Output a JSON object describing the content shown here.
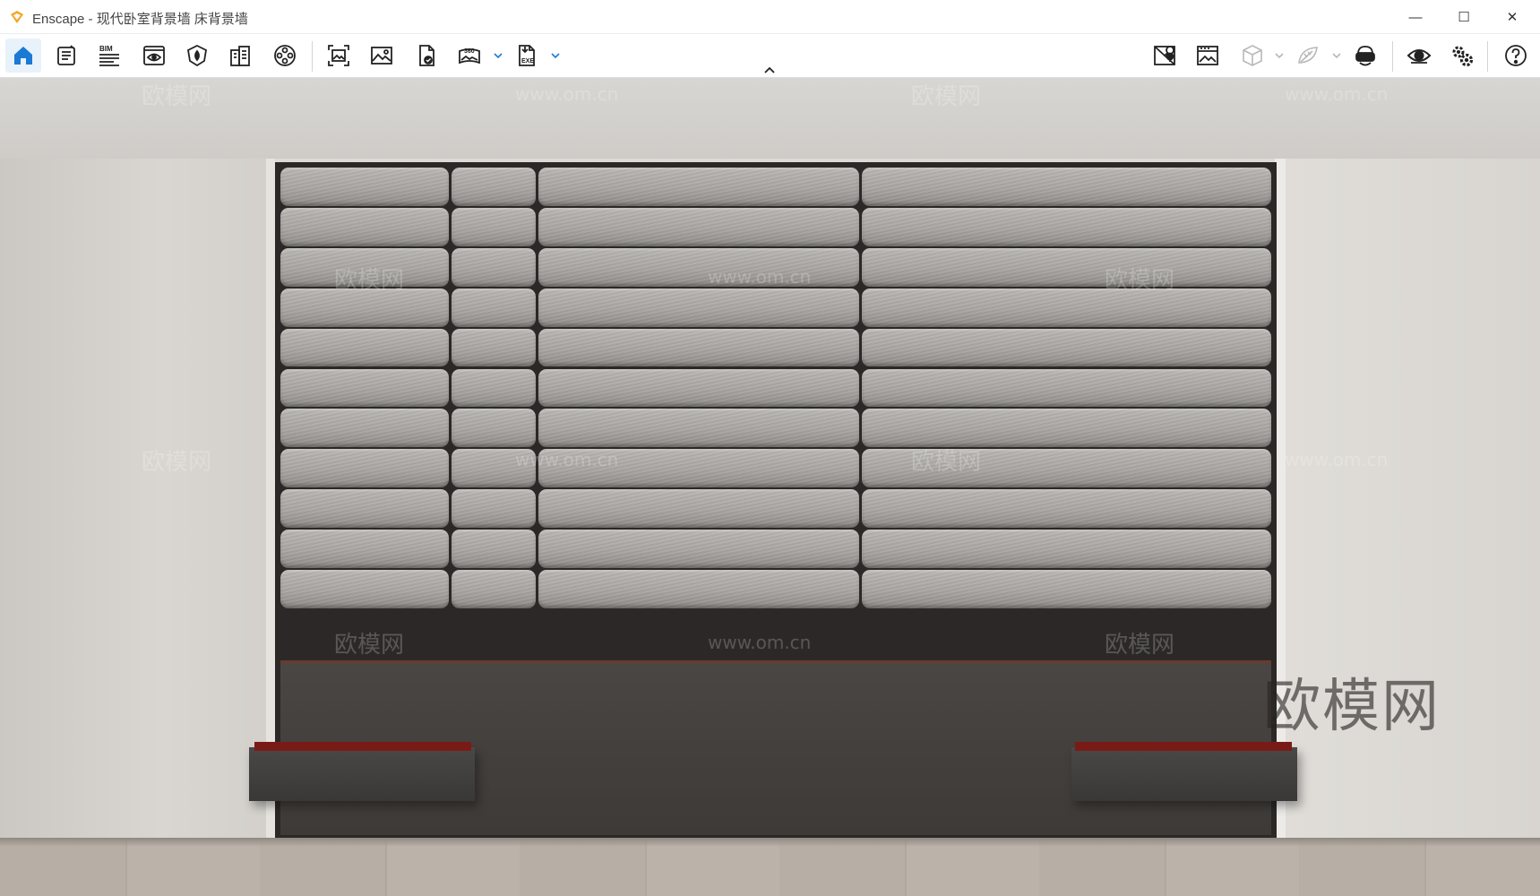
{
  "window": {
    "title": "Enscape - 现代卧室背景墙 床背景墙",
    "controls": {
      "minimize": "—",
      "maximize": "☐",
      "close": "✕"
    },
    "accent_color": "#1a7ad4",
    "logo_color": "#f5a623"
  },
  "toolbar": {
    "left_tools": [
      {
        "id": "home",
        "icon": "home-icon",
        "active": true
      },
      {
        "id": "project-info",
        "icon": "document-list-icon"
      },
      {
        "id": "bim",
        "icon": "bim-icon",
        "label": "BIM"
      },
      {
        "id": "views",
        "icon": "eye-window-icon"
      },
      {
        "id": "materials",
        "icon": "shield-leaf-icon"
      },
      {
        "id": "asset-library",
        "icon": "building-icon"
      },
      {
        "id": "video",
        "icon": "film-reel-icon"
      },
      {
        "id": "screenshot",
        "icon": "frame-capture-icon"
      },
      {
        "id": "render-image",
        "icon": "image-icon"
      },
      {
        "id": "export-file",
        "icon": "file-check-icon"
      },
      {
        "id": "panorama",
        "icon": "panorama-360-icon",
        "label": "360"
      },
      {
        "id": "export-exe",
        "icon": "file-exe-icon",
        "label": "EXE"
      }
    ],
    "right_tools": [
      {
        "id": "map",
        "icon": "map-pin-icon"
      },
      {
        "id": "batch-render",
        "icon": "image-grid-icon"
      },
      {
        "id": "cube-view",
        "icon": "cube-icon"
      },
      {
        "id": "leaf-tool",
        "icon": "leaf-icon"
      },
      {
        "id": "vr-headset",
        "icon": "vr-headset-icon"
      },
      {
        "id": "visual-settings",
        "icon": "eye-icon"
      },
      {
        "id": "settings",
        "icon": "gears-icon"
      },
      {
        "id": "help",
        "icon": "help-circle-icon"
      }
    ]
  },
  "viewport": {
    "watermarks": [
      "欧模网",
      "www.om.cn"
    ],
    "brand_watermark": "欧模网",
    "colors": {
      "upholstery": "#aeaaa7",
      "frame": "#2b2827",
      "drawer_inner": "#7a1a16",
      "floor": "#b7afa6"
    }
  }
}
